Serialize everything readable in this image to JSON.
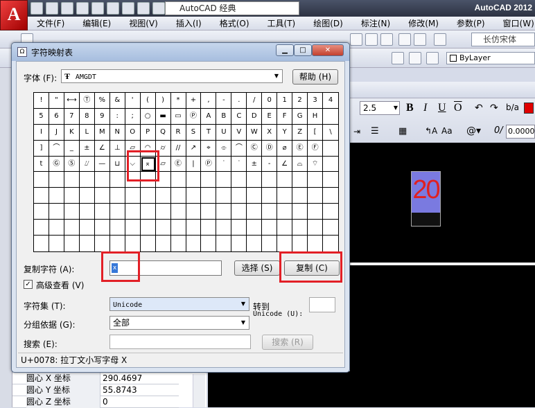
{
  "app": {
    "name": "AutoCAD 2012",
    "logo_letter": "A",
    "workspace": "AutoCAD 经典"
  },
  "menu": [
    "文件(F)",
    "编辑(E)",
    "视图(V)",
    "插入(I)",
    "格式(O)",
    "工具(T)",
    "绘图(D)",
    "标注(N)",
    "修改(M)",
    "参数(P)",
    "窗口(W)"
  ],
  "toolbar": {
    "font_name": "长仿宋体",
    "layer": "ByLayer",
    "text_height": "2.5",
    "width_factor": "0.0000",
    "bold": "B",
    "italic": "I",
    "underline": "U",
    "overline": "O"
  },
  "drawing": {
    "mtext_value": "20"
  },
  "properties": [
    {
      "label": "圆心 X 坐标",
      "value": "290.4697"
    },
    {
      "label": "圆心 Y 坐标",
      "value": "55.8743"
    },
    {
      "label": "圆心 Z 坐标",
      "value": "0"
    }
  ],
  "dialog": {
    "title": "字符映射表",
    "font_label": "字体 (F):",
    "font_value": "AMGDT",
    "font_icon": "Ŧ",
    "help_button": "帮助 (H)",
    "copy_chars_label": "复制字符 (A):",
    "copy_chars_value": "x",
    "select_button": "选择 (S)",
    "copy_button": "复制 (C)",
    "advanced_label": "高级查看 (V)",
    "advanced_checked": "✓",
    "charset_label": "字符集 (T):",
    "charset_value": "Unicode",
    "goto_label": "转到",
    "goto_unicode_label": "Unicode (U):",
    "group_label": "分组依据 (G):",
    "group_value": "全部",
    "search_label": "搜索 (E):",
    "search_button": "搜索 (R)",
    "status": "U+0078: 拉丁文小写字母 X",
    "grid": [
      [
        "!",
        "\"",
        "⟷",
        "Ⓣ",
        "%",
        "&",
        "'",
        "(",
        ")",
        "*",
        "+",
        ",",
        "-",
        ".",
        "/",
        "0",
        "1",
        "2",
        "3",
        "4"
      ],
      [
        "5",
        "6",
        "7",
        "8",
        "9",
        ":",
        ";",
        "○",
        "▬",
        "▭",
        "Ⓟ",
        "A",
        "B",
        "C",
        "D",
        "E",
        "F",
        "G",
        "H"
      ],
      [
        "I",
        "J",
        "K",
        "L",
        "M",
        "N",
        "O",
        "P",
        "Q",
        "R",
        "S",
        "T",
        "U",
        "V",
        "W",
        "X",
        "Y",
        "Z",
        "[",
        "\\"
      ],
      [
        "]",
        "⌒",
        "_",
        "±",
        "∠",
        "⊥",
        "▱",
        "◠",
        "⌭",
        "//",
        "↗",
        "⌖",
        "⌯",
        "⌒",
        "Ⓒ",
        "Ⓓ",
        "⌀",
        "Ⓔ",
        "Ⓕ"
      ],
      [
        "t",
        "Ⓖ",
        "Ⓢ",
        "⌰",
        "—",
        "⊔",
        "⌵",
        "⌅",
        "⏥",
        "Ⓔ",
        "|",
        "Ⓟ",
        "˙",
        "˙",
        "±",
        "-",
        "∠",
        "⌓",
        "⌔"
      ],
      [],
      [],
      [],
      [],
      []
    ]
  }
}
